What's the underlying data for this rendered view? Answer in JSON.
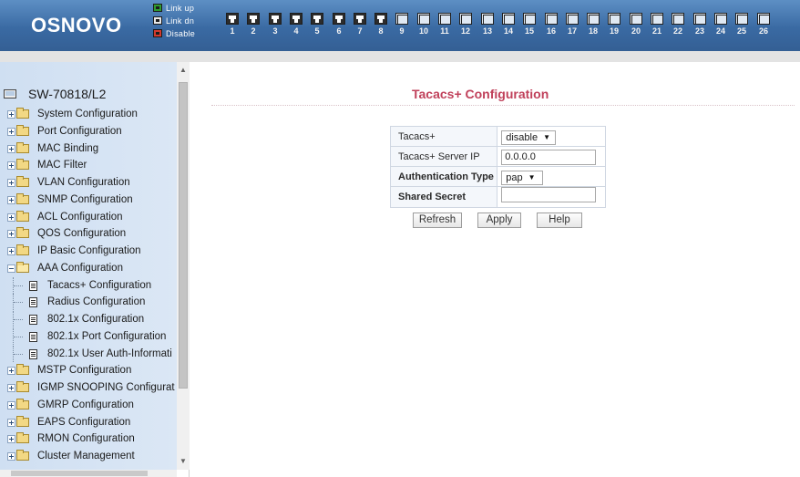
{
  "header": {
    "logo": "OSNOVO",
    "legend": [
      {
        "label": "Link up",
        "icon": "link-up-icon"
      },
      {
        "label": "Link dn",
        "icon": "link-down-icon"
      },
      {
        "label": "Disable",
        "icon": "disable-icon"
      }
    ],
    "ports": [
      {
        "num": "1",
        "state": "up"
      },
      {
        "num": "2",
        "state": "up"
      },
      {
        "num": "3",
        "state": "up"
      },
      {
        "num": "4",
        "state": "up"
      },
      {
        "num": "5",
        "state": "up"
      },
      {
        "num": "6",
        "state": "up"
      },
      {
        "num": "7",
        "state": "up"
      },
      {
        "num": "8",
        "state": "up"
      },
      {
        "num": "9",
        "state": "dn"
      },
      {
        "num": "10",
        "state": "dn"
      },
      {
        "num": "11",
        "state": "dn"
      },
      {
        "num": "12",
        "state": "dn"
      },
      {
        "num": "13",
        "state": "dn"
      },
      {
        "num": "14",
        "state": "dn"
      },
      {
        "num": "15",
        "state": "dn"
      },
      {
        "num": "16",
        "state": "dn"
      },
      {
        "num": "17",
        "state": "dn"
      },
      {
        "num": "18",
        "state": "dn"
      },
      {
        "num": "19",
        "state": "dn"
      },
      {
        "num": "20",
        "state": "dn"
      },
      {
        "num": "21",
        "state": "dn"
      },
      {
        "num": "22",
        "state": "dn"
      },
      {
        "num": "23",
        "state": "dn"
      },
      {
        "num": "24",
        "state": "dn"
      },
      {
        "num": "25",
        "state": "dn"
      },
      {
        "num": "26",
        "state": "dn"
      }
    ]
  },
  "tree": {
    "root": "SW-70818/L2",
    "items": [
      {
        "label": "System Configuration",
        "type": "folder",
        "expanded": false
      },
      {
        "label": "Port Configuration",
        "type": "folder",
        "expanded": false
      },
      {
        "label": "MAC Binding",
        "type": "folder",
        "expanded": false
      },
      {
        "label": "MAC Filter",
        "type": "folder",
        "expanded": false
      },
      {
        "label": "VLAN Configuration",
        "type": "folder",
        "expanded": false
      },
      {
        "label": "SNMP Configuration",
        "type": "folder",
        "expanded": false
      },
      {
        "label": "ACL Configuration",
        "type": "folder",
        "expanded": false
      },
      {
        "label": "QOS Configuration",
        "type": "folder",
        "expanded": false
      },
      {
        "label": "IP Basic Configuration",
        "type": "folder",
        "expanded": false
      },
      {
        "label": "AAA Configuration",
        "type": "folder",
        "expanded": true
      },
      {
        "label": "Tacacs+ Configuration",
        "type": "leaf"
      },
      {
        "label": "Radius Configuration",
        "type": "leaf"
      },
      {
        "label": "802.1x Configuration",
        "type": "leaf"
      },
      {
        "label": "802.1x Port Configuration",
        "type": "leaf"
      },
      {
        "label": "802.1x User Auth-Informati",
        "type": "leaf"
      },
      {
        "label": "MSTP Configuration",
        "type": "folder",
        "expanded": false
      },
      {
        "label": "IGMP SNOOPING Configurat",
        "type": "folder",
        "expanded": false
      },
      {
        "label": "GMRP Configuration",
        "type": "folder",
        "expanded": false
      },
      {
        "label": "EAPS Configuration",
        "type": "folder",
        "expanded": false
      },
      {
        "label": "RMON Configuration",
        "type": "folder",
        "expanded": false
      },
      {
        "label": "Cluster Management",
        "type": "folder",
        "expanded": false
      }
    ]
  },
  "main": {
    "title": "Tacacs+ Configuration",
    "fields": {
      "tacacs_label": "Tacacs+",
      "tacacs_value": "disable",
      "server_ip_label": "Tacacs+ Server IP",
      "server_ip_value": "0.0.0.0",
      "auth_type_label": "Authentication Type",
      "auth_type_value": "pap",
      "secret_label": "Shared Secret",
      "secret_value": ""
    },
    "buttons": {
      "refresh": "Refresh",
      "apply": "Apply",
      "help": "Help"
    }
  },
  "colors": {
    "header_bg": "#3a6aa3",
    "title": "#c0405a",
    "tree_bg": "#d5e3f4"
  }
}
